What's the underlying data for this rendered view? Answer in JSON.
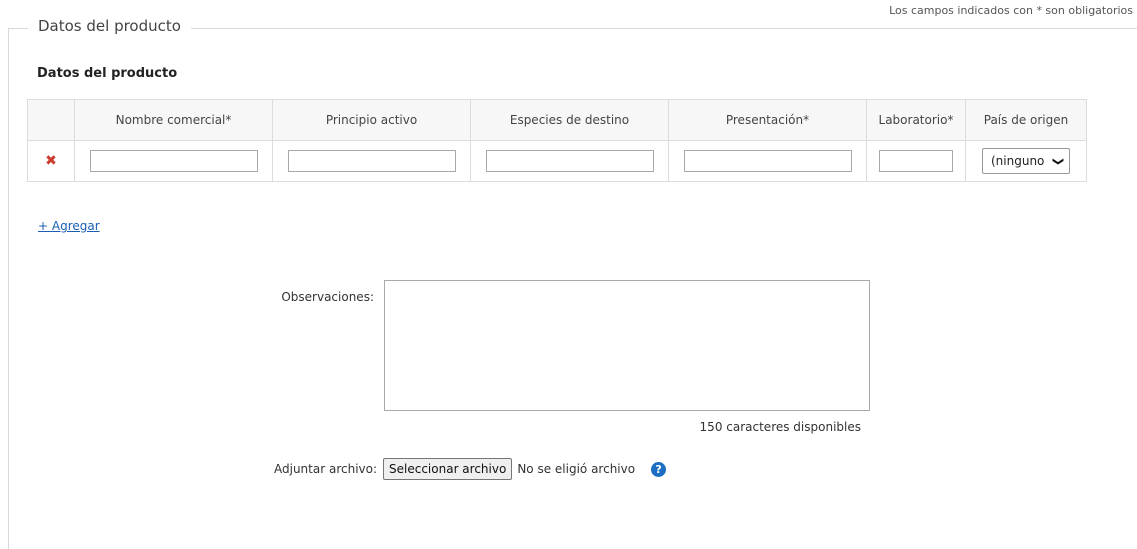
{
  "required_note": "Los campos indicados con * son obligatorios",
  "fieldset": {
    "legend": "Datos del producto"
  },
  "section": {
    "title": "Datos del producto"
  },
  "table": {
    "headers": [
      "",
      "Nombre comercial*",
      "Principio activo",
      "Especies de destino",
      "Presentación*",
      "Laboratorio*",
      "País de origen"
    ],
    "row": {
      "delete_icon": "close-icon",
      "nombre_comercial": "",
      "principio_activo": "",
      "especies_destino": "",
      "presentacion": "",
      "laboratorio": "",
      "pais_origen": "(ninguno"
    }
  },
  "add_link": "+ Agregar",
  "observaciones": {
    "label": "Observaciones:",
    "value": "",
    "chars_available": "150 caracteres disponibles"
  },
  "adjuntar": {
    "label": "Adjuntar archivo:",
    "button_label": "Seleccionar archivo",
    "status": "No se eligió archivo",
    "help_icon": "question-icon",
    "help_glyph": "?"
  },
  "colors": {
    "delete_icon": "#cc3a2e",
    "link": "#1a5fb4",
    "help_icon": "#1b6ec2"
  }
}
